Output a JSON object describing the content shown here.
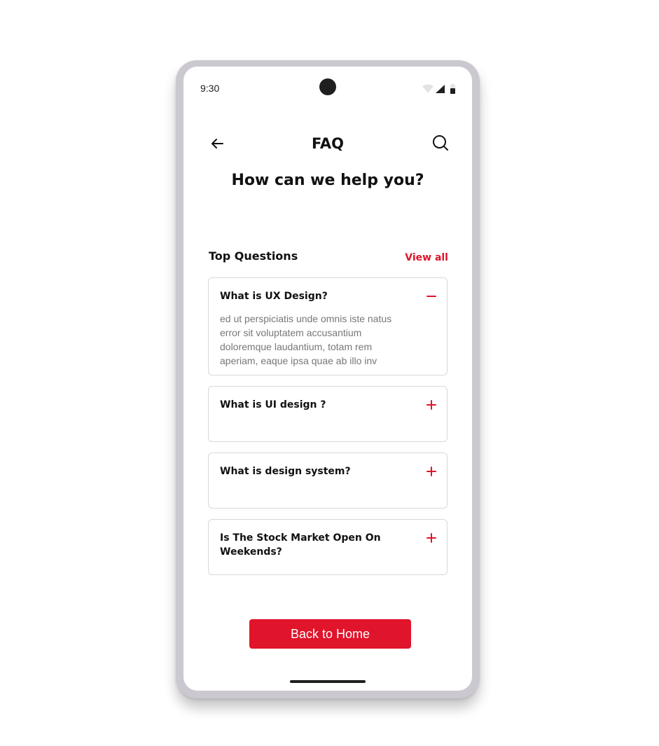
{
  "status_bar": {
    "time": "9:30",
    "icons": [
      "wifi-icon",
      "cellular-signal-icon",
      "battery-icon"
    ]
  },
  "header": {
    "title": "FAQ",
    "back_icon": "arrow-left-icon",
    "search_icon": "search-icon"
  },
  "subtitle": "How can we help you?",
  "section": {
    "title": "Top Questions",
    "view_all_label": "View all"
  },
  "faqs": [
    {
      "question": "What is UX Design?",
      "answer": "ed ut perspiciatis unde omnis iste natus error sit voluptatem accusantium doloremque laudantium, totam rem aperiam, eaque ipsa quae ab illo inv",
      "expanded": true,
      "toggle_icon": "minus-icon"
    },
    {
      "question": "What is UI design ?",
      "expanded": false,
      "toggle_icon": "plus-icon"
    },
    {
      "question": "What is design system?",
      "expanded": false,
      "toggle_icon": "plus-icon"
    },
    {
      "question": "Is The Stock Market Open On Weekends?",
      "expanded": false,
      "toggle_icon": "plus-icon"
    }
  ],
  "cta": {
    "label": "Back to Home"
  },
  "colors": {
    "accent": "#e0142a",
    "frame": "#cbc8d0",
    "card_border": "#d8d8d8",
    "text": "#111111",
    "muted_text": "#777777"
  }
}
